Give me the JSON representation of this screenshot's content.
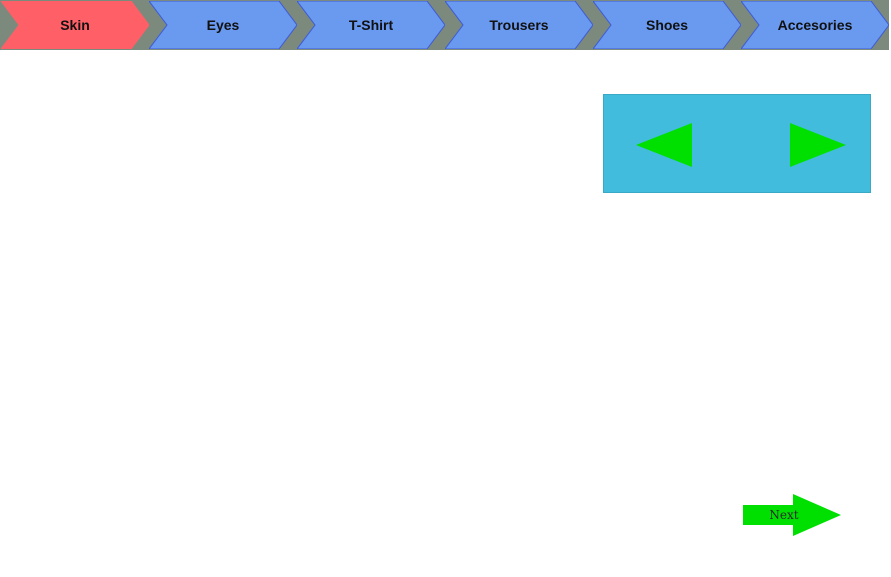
{
  "colors": {
    "step_active": "#ff6068",
    "step_inactive": "#6a99f0",
    "step_border": "#3e5bd6",
    "step_bar_bg": "#7b8a7c",
    "selector_bg": "#41bcdc",
    "arrow_green": "#00e000"
  },
  "steps": [
    {
      "label": "Skin",
      "active": true
    },
    {
      "label": "Eyes",
      "active": false
    },
    {
      "label": "T-Shirt",
      "active": false
    },
    {
      "label": "Trousers",
      "active": false
    },
    {
      "label": "Shoes",
      "active": false
    },
    {
      "label": "Accesories",
      "active": false
    }
  ],
  "selector": {
    "prev_icon": "triangle-left-icon",
    "next_icon": "triangle-right-icon"
  },
  "next_button": {
    "label": "Next",
    "icon": "arrow-right-icon"
  }
}
